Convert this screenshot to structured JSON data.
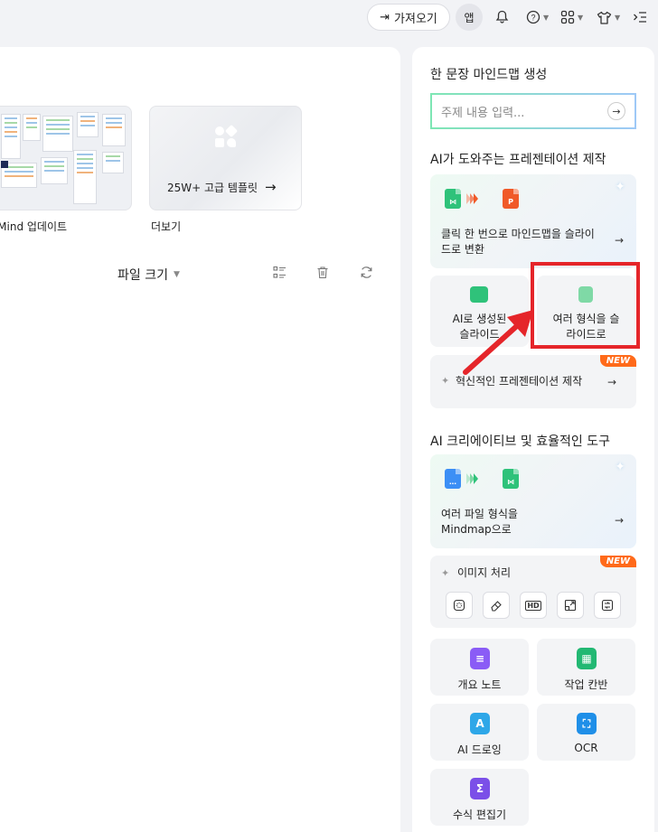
{
  "topbar": {
    "import_label": "가져오기",
    "app_label": "앱",
    "icons": [
      "import-icon",
      "bell-icon",
      "help-icon",
      "apps-grid-icon",
      "shirt-icon",
      "collapse-icon"
    ]
  },
  "main": {
    "templates": [
      {
        "caption": "awMind 업데이트"
      },
      {
        "caption": "더보기",
        "overlay_label": "25W+ 고급 템플릿"
      }
    ],
    "sort_label": "파일 크기"
  },
  "side": {
    "mindmap_title": "한 문장 마인드맵 생성",
    "topic_placeholder": "주제 내용 입력...",
    "presentation_title": "AI가 도와주는 프레젠테이션 제작",
    "convert_card_text": "클릭 한 번으로 마인드맵을 슬라이드로 변환",
    "ai_slide_label": "AI로 생성된 슬라이드",
    "multi_format_label": "여러 형식을 슬라이드로",
    "innovative_label": "혁신적인 프레젠테이션 제작",
    "new_badge": "NEW",
    "creative_title": "AI 크리에이티브 및 효율적인 도구",
    "files_to_mindmap": "여러 파일 형식을 Mindmap으로",
    "image_processing": "이미지 처리",
    "image_tools": [
      {
        "label": ""
      },
      {
        "label": ""
      },
      {
        "label": "HD"
      },
      {
        "label": ""
      },
      {
        "label": ""
      }
    ],
    "tools": [
      {
        "label": "개요 노트",
        "color": "#8a5cf6"
      },
      {
        "label": "작업 칸반",
        "color": "#22b873"
      },
      {
        "label": "AI 드로잉",
        "color": "#2ea7e8"
      },
      {
        "label": "OCR",
        "color": "#1f8fe8"
      },
      {
        "label": "수식 편집기",
        "color": "#7b4fe8"
      }
    ]
  },
  "colors": {
    "accent_red": "#e5252a",
    "new_orange": "#ff6a1a",
    "green": "#2fc27a",
    "orange": "#f05a28",
    "blue": "#3c8ff5"
  }
}
